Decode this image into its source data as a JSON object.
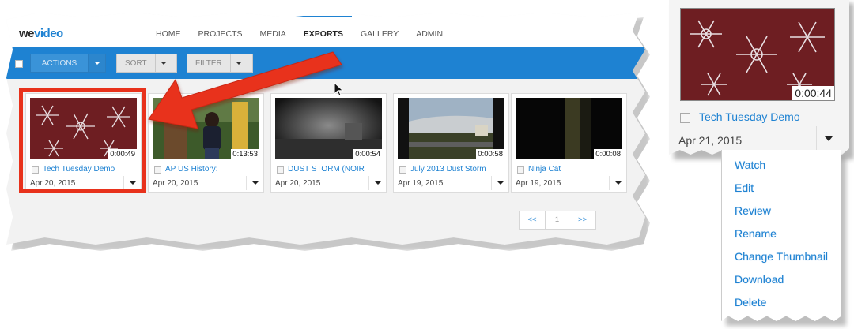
{
  "app": {
    "logo": {
      "part1": "we",
      "part2": "video"
    },
    "nav": [
      {
        "label": "HOME",
        "active": false
      },
      {
        "label": "PROJECTS",
        "active": false
      },
      {
        "label": "MEDIA",
        "active": false
      },
      {
        "label": "EXPORTS",
        "active": true
      },
      {
        "label": "GALLERY",
        "active": false
      },
      {
        "label": "ADMIN",
        "active": false
      }
    ],
    "accent_color": "#1e82d2",
    "highlight_color": "#e8321c"
  },
  "toolbar": {
    "actions_label": "ACTIONS",
    "sort_label": "SORT",
    "filter_label": "FILTER"
  },
  "videos": [
    {
      "title": "Tech Tuesday Demo",
      "duration": "0:00:49",
      "date": "Apr 20, 2015",
      "thumb": "red-snowflakes"
    },
    {
      "title": "AP US History:",
      "duration": "0:13:53",
      "date": "Apr 20, 2015",
      "thumb": "person-outdoors"
    },
    {
      "title": "DUST STORM (NOIR",
      "duration": "0:00:54",
      "date": "Apr 20, 2015",
      "thumb": "grey-noir-scene"
    },
    {
      "title": "July 2013 Dust Storm",
      "duration": "0:00:58",
      "date": "Apr 19, 2015",
      "thumb": "sky-street"
    },
    {
      "title": "Ninja Cat",
      "duration": "0:00:08",
      "date": "Apr 19, 2015",
      "thumb": "dark-doorway"
    }
  ],
  "pagination": {
    "prev": "<<",
    "current": "1",
    "next": ">>"
  },
  "zoom": {
    "title": "Tech Tuesday Demo",
    "duration": "0:00:44",
    "date": "Apr 21, 2015",
    "menu_items": [
      "Watch",
      "Edit",
      "Review",
      "Rename",
      "Change Thumbnail",
      "Download",
      "Delete"
    ]
  }
}
